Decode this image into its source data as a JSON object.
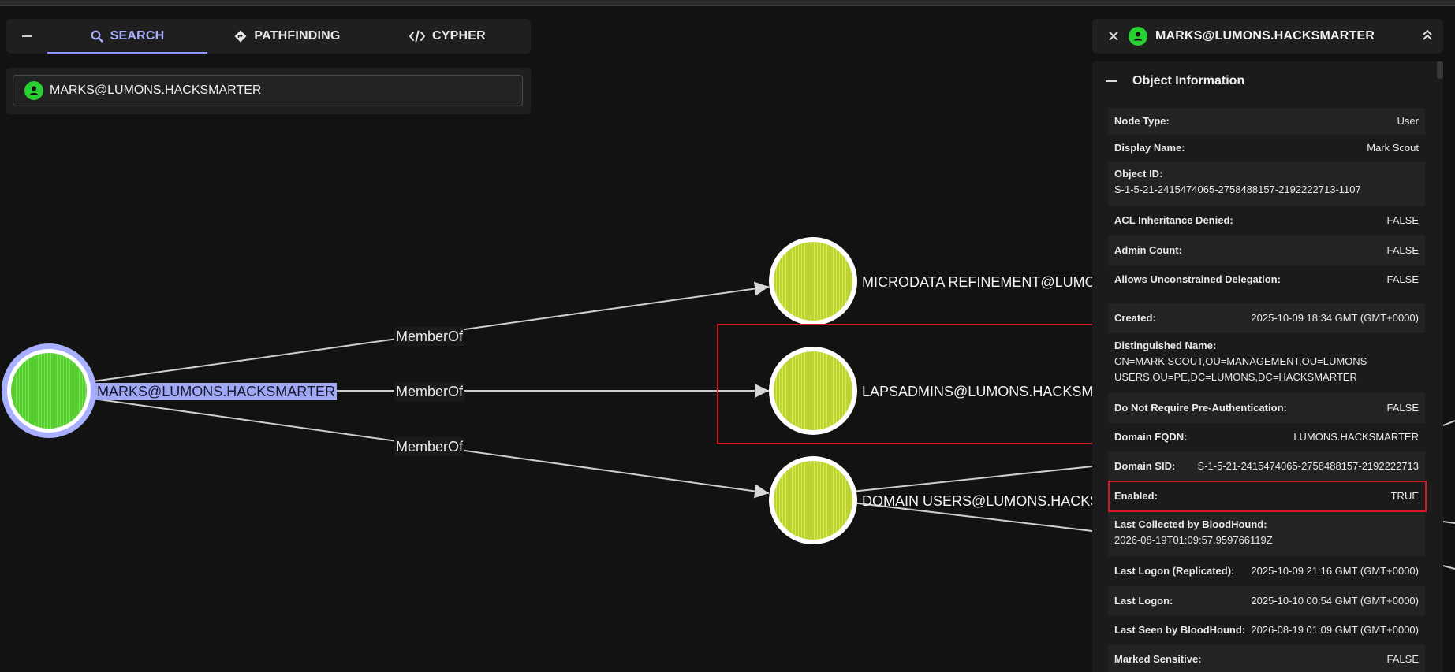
{
  "search_panel": {
    "tabs": [
      {
        "label": "SEARCH",
        "icon": "search-icon",
        "active": true
      },
      {
        "label": "PATHFINDING",
        "icon": "diamond-route-icon",
        "active": false
      },
      {
        "label": "CYPHER",
        "icon": "code-icon",
        "active": false
      }
    ],
    "search_value": "MARKS@LUMONS.HACKSMARTER"
  },
  "graph": {
    "source_node": {
      "label": "MARKS@LUMONS.HACKSMARTER",
      "color": "#5fd33c"
    },
    "target_nodes": [
      {
        "label": "MICRODATA REFINEMENT@LUMONS",
        "color": "#c3d63a"
      },
      {
        "label": "LAPSADMINS@LUMONS.HACKSM",
        "color": "#c3d63a"
      },
      {
        "label": "DOMAIN USERS@LUMONS.HACKS",
        "color": "#c3d63a"
      }
    ],
    "edges": [
      {
        "label": "MemberOf"
      },
      {
        "label": "MemberOf"
      },
      {
        "label": "MemberOf"
      }
    ]
  },
  "detail": {
    "title": "MARKS@LUMONS.HACKSMARTER",
    "section_title": "Object Information",
    "props": {
      "node_type": {
        "k": "Node Type:",
        "v": "User"
      },
      "display_name": {
        "k": "Display Name:",
        "v": "Mark Scout"
      },
      "object_id": {
        "k": "Object ID:",
        "v": "S-1-5-21-2415474065-2758488157-2192222713-1107"
      },
      "acl_inheritance": {
        "k": "ACL Inheritance Denied:",
        "v": "FALSE"
      },
      "admin_count": {
        "k": "Admin Count:",
        "v": "FALSE"
      },
      "unconstrained": {
        "k": "Allows Unconstrained Delegation:",
        "v": "FALSE"
      },
      "created": {
        "k": "Created:",
        "v": "2025-10-09 18:34 GMT (GMT+0000)"
      },
      "dn": {
        "k": "Distinguished Name:",
        "v1": "CN=MARK SCOUT,OU=MANAGEMENT,OU=LUMONS",
        "v2": "USERS,OU=PE,DC=LUMONS,DC=HACKSMARTER"
      },
      "no_preauth": {
        "k": "Do Not Require Pre-Authentication:",
        "v": "FALSE"
      },
      "domain_fqdn": {
        "k": "Domain FQDN:",
        "v": "LUMONS.HACKSMARTER"
      },
      "domain_sid": {
        "k": "Domain SID:",
        "v": "S-1-5-21-2415474065-2758488157-2192222713"
      },
      "enabled": {
        "k": "Enabled:",
        "v": "TRUE"
      },
      "last_collected": {
        "k": "Last Collected by BloodHound:",
        "v": "2026-08-19T01:09:57.959766119Z"
      },
      "last_logon_repl": {
        "k": "Last Logon (Replicated):",
        "v": "2025-10-09 21:16 GMT (GMT+0000)"
      },
      "last_logon": {
        "k": "Last Logon:",
        "v": "2025-10-10 00:54 GMT (GMT+0000)"
      },
      "last_seen": {
        "k": "Last Seen by BloodHound:",
        "v": "2026-08-19 01:09 GMT (GMT+0000)"
      },
      "marked_sensitive": {
        "k": "Marked Sensitive:",
        "v": "FALSE"
      }
    }
  },
  "colors": {
    "accent": "#8e96ff",
    "user_green": "#28d032",
    "group_yellow": "#c3d63a",
    "highlight_red": "#d8182a"
  }
}
